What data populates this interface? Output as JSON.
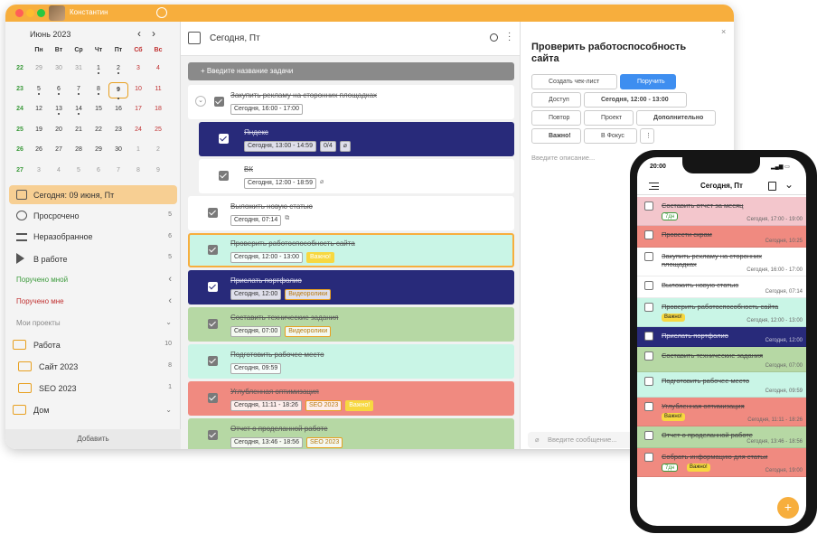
{
  "app": {
    "user_name": "Константин"
  },
  "calendar": {
    "month": "Июнь 2023",
    "weekdays": [
      "Пн",
      "Вт",
      "Ср",
      "Чт",
      "Пт",
      "Сб",
      "Вс"
    ],
    "weeks": [
      {
        "num": "22",
        "days": [
          "29",
          "30",
          "31",
          "1",
          "2",
          "3",
          "4"
        ]
      },
      {
        "num": "23",
        "days": [
          "5",
          "6",
          "7",
          "8",
          "9",
          "10",
          "11"
        ]
      },
      {
        "num": "24",
        "days": [
          "12",
          "13",
          "14",
          "15",
          "16",
          "17",
          "18"
        ]
      },
      {
        "num": "25",
        "days": [
          "19",
          "20",
          "21",
          "22",
          "23",
          "24",
          "25"
        ]
      },
      {
        "num": "26",
        "days": [
          "26",
          "27",
          "28",
          "29",
          "30",
          "1",
          "2"
        ]
      },
      {
        "num": "27",
        "days": [
          "3",
          "4",
          "5",
          "6",
          "7",
          "8",
          "9"
        ]
      }
    ]
  },
  "sidebar": {
    "today": "Сегодня: 09 июня, Пт",
    "items": [
      {
        "label": "Просрочено",
        "count": "5"
      },
      {
        "label": "Неразобранное",
        "count": "6"
      },
      {
        "label": "В работе",
        "count": "5"
      }
    ],
    "assigned_by_me": "Поручено мной",
    "assigned_to_me": "Поручено мне",
    "my_projects": "Мои проекты",
    "projects": [
      {
        "label": "Работа",
        "count": "10"
      },
      {
        "label": "Сайт 2023",
        "count": "8"
      },
      {
        "label": "SEO 2023",
        "count": "1"
      },
      {
        "label": "Дом",
        "count": ""
      }
    ],
    "add_label": "Добавить"
  },
  "main": {
    "header": "Сегодня, Пт",
    "new_task_placeholder": "Введите название задачи",
    "tasks": [
      {
        "title": "Закупить рекламу на сторонних площадках",
        "date": "Сегодня, 16:00 - 17:00"
      },
      {
        "title": "Яндекс",
        "date": "Сегодня, 13:00 - 14:59",
        "extra": "0/4"
      },
      {
        "title": "ВК",
        "date": "Сегодня, 12:00 - 18:59"
      },
      {
        "title": "Выложить новую статью",
        "date": "Сегодня, 07:14"
      },
      {
        "title": "Проверить работоспособность сайта",
        "date": "Сегодня, 12:00 - 13:00",
        "tag": "Важно!"
      },
      {
        "title": "Прислать портфолио",
        "date": "Сегодня, 12:00",
        "project": "Видеоролики"
      },
      {
        "title": "Составить технические задания",
        "date": "Сегодня, 07:00",
        "project": "Видеоролики"
      },
      {
        "title": "Подготовить рабочее место",
        "date": "Сегодня, 09:59"
      },
      {
        "title": "Углубленная оптимизация",
        "date": "Сегодня, 11:11 - 18:26",
        "project": "SEO 2023",
        "tag": "Важно!"
      },
      {
        "title": "Отчет о проделанной работе",
        "date": "Сегодня, 13:46 - 18:56",
        "project": "SEO 2023"
      }
    ]
  },
  "detail": {
    "title": "Проверить работоспособность сайта",
    "buttons": {
      "checklist": "Создать чек-лист",
      "assign": "Поручить",
      "access": "Доступ",
      "date": "Сегодня, 12:00 - 13:00",
      "repeat": "Повтор",
      "project": "Проект",
      "more": "Дополнительно",
      "important": "Важно!",
      "focus": "В Фокус"
    },
    "description_placeholder": "Введите описание...",
    "message_placeholder": "Введите сообщение..."
  },
  "phone": {
    "time": "20:00",
    "header": "Сегодня, Пт",
    "tasks": [
      {
        "title": "Составить отчет за месяц",
        "badge": "7дн",
        "date": "Сегодня, 17:00 - 19:00"
      },
      {
        "title": "Провести скрам",
        "date": "Сегодня, 10:25"
      },
      {
        "title": "Закупить рекламу на сторонних площадках",
        "date": "Сегодня, 16:00 - 17:00"
      },
      {
        "title": "Выложить новую статью",
        "date": "Сегодня, 07:14"
      },
      {
        "title": "Проверить работоспособность сайта",
        "tag": "Важно!",
        "date": "Сегодня, 12:00 - 13:00"
      },
      {
        "title": "Прислать портфолио",
        "date": "Сегодня, 12:00"
      },
      {
        "title": "Составить технические задания",
        "date": "Сегодня, 07:00"
      },
      {
        "title": "Подготовить рабочее место",
        "date": "Сегодня, 09:59"
      },
      {
        "title": "Углубленная оптимизация",
        "tag": "Важно!",
        "date": "Сегодня, 11:11 - 18:26"
      },
      {
        "title": "Отчет о проделанной работе",
        "date": "Сегодня, 13:46 - 18:56"
      },
      {
        "title": "Собрать информацию для статьи",
        "badge": "7дн",
        "tag": "Важно!",
        "date": "Сегодня, 19:00"
      }
    ]
  },
  "colors": {
    "accent": "#f7ae3d",
    "navy": "#282a7a",
    "green": "#b6d8a4",
    "mint": "#c9f5e6",
    "red": "#f08a80",
    "pink": "#f3c6cc",
    "blue": "#3e8ef0"
  }
}
